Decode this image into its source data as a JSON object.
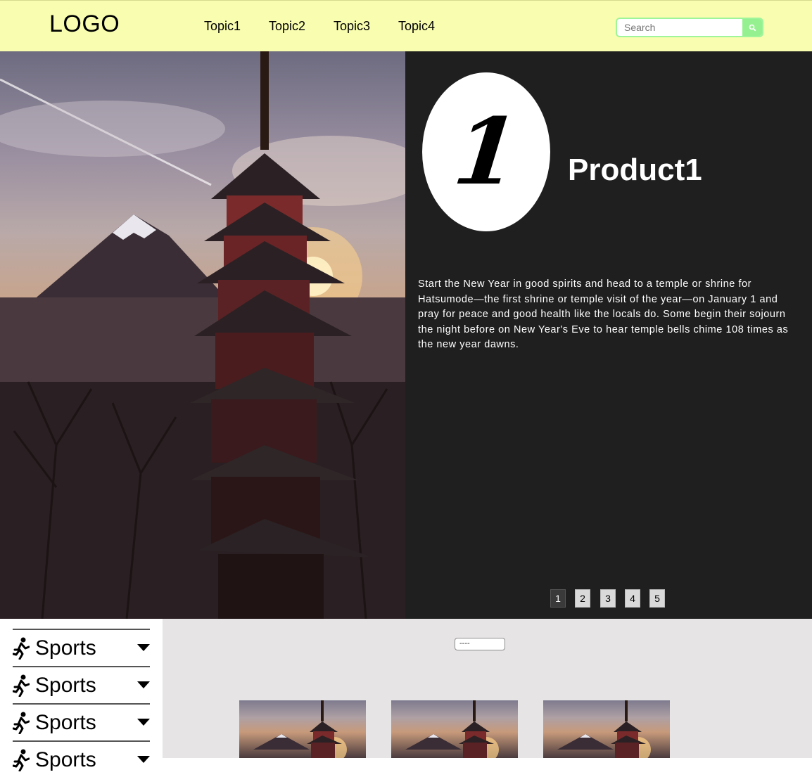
{
  "header": {
    "logo": "LOGO",
    "nav": [
      {
        "label": "Topic1"
      },
      {
        "label": "Topic2"
      },
      {
        "label": "Topic3"
      },
      {
        "label": "Topic4"
      }
    ],
    "search": {
      "placeholder": "Search",
      "value": "",
      "icon": "search-icon"
    }
  },
  "hero": {
    "badge_number": "1",
    "product_title": "Product1",
    "description": "Start the New Year in good spirits and head to a temple or shrine for Hatsumode—the first shrine or temple visit of the year—on January 1 and pray for peace and good health like the locals do. Some begin their sojourn the night before on New Year's Eve to hear temple bells chime 108 times as the new year dawns.",
    "pages": [
      "1",
      "2",
      "3",
      "4",
      "5"
    ],
    "active_page": "1"
  },
  "sidebar": {
    "items": [
      {
        "label": "Sports",
        "icon": "running-person-icon"
      },
      {
        "label": "Sports",
        "icon": "running-person-icon"
      },
      {
        "label": "Sports",
        "icon": "running-person-icon"
      },
      {
        "label": "Sports",
        "icon": "running-person-icon"
      }
    ]
  },
  "content": {
    "select": {
      "selected": "----"
    },
    "thumbnails": 3
  },
  "colors": {
    "header_bg": "#f8fdaf",
    "search_accent": "#95f18f",
    "hero_panel_bg": "#1f1f1f",
    "content_bg": "#e6e4e4"
  }
}
